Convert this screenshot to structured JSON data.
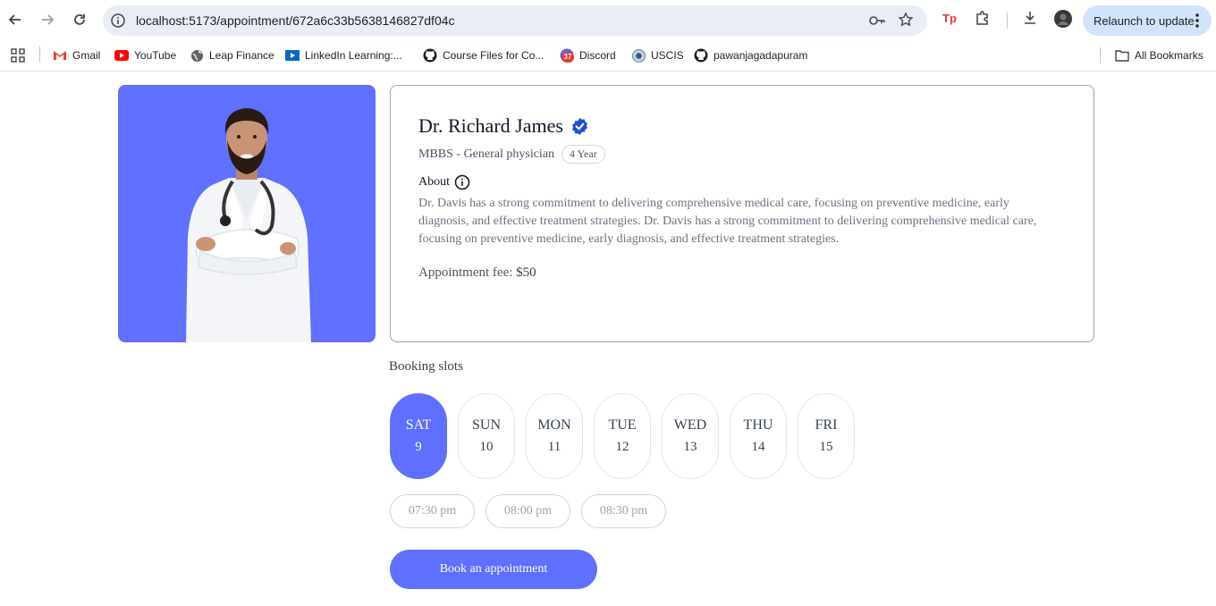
{
  "browser": {
    "url": "localhost:5173/appointment/672a6c33b5638146827df04c",
    "relaunch_label": "Relaunch to update",
    "bookmarks": [
      {
        "label": "Gmail",
        "icon": "gmail-icon"
      },
      {
        "label": "YouTube",
        "icon": "youtube-icon"
      },
      {
        "label": "Leap Finance",
        "icon": "globe-icon"
      },
      {
        "label": "LinkedIn Learning:...",
        "icon": "linkedin-learning-icon"
      },
      {
        "label": "Course Files for Co...",
        "icon": "github-icon"
      },
      {
        "label": "Discord",
        "icon": "discord-icon",
        "badge": "37"
      },
      {
        "label": "USCIS",
        "icon": "uscis-icon"
      },
      {
        "label": "pawanjagadapuram",
        "icon": "github-icon"
      }
    ],
    "all_bookmarks": "All Bookmarks"
  },
  "doctor": {
    "name": "Dr. Richard James",
    "degree": "MBBS - General physician",
    "experience": "4 Year",
    "about_label": "About",
    "about": "Dr. Davis has a strong commitment to delivering comprehensive medical care, focusing on preventive medicine, early diagnosis, and effective treatment strategies. Dr. Davis has a strong commitment to delivering comprehensive medical care, focusing on preventive medicine, early diagnosis, and effective treatment strategies.",
    "fee_label": "Appointment fee: ",
    "fee_value": "$50"
  },
  "booking": {
    "title": "Booking slots",
    "days": [
      {
        "name": "SAT",
        "date": "9",
        "selected": true
      },
      {
        "name": "SUN",
        "date": "10",
        "selected": false
      },
      {
        "name": "MON",
        "date": "11",
        "selected": false
      },
      {
        "name": "TUE",
        "date": "12",
        "selected": false
      },
      {
        "name": "WED",
        "date": "13",
        "selected": false
      },
      {
        "name": "THU",
        "date": "14",
        "selected": false
      },
      {
        "name": "FRI",
        "date": "15",
        "selected": false
      }
    ],
    "times": [
      "07:30 pm",
      "08:00 pm",
      "08:30 pm"
    ],
    "button": "Book an appointment"
  },
  "colors": {
    "primary": "#5f6fff",
    "verified": "#1d4ed8"
  }
}
